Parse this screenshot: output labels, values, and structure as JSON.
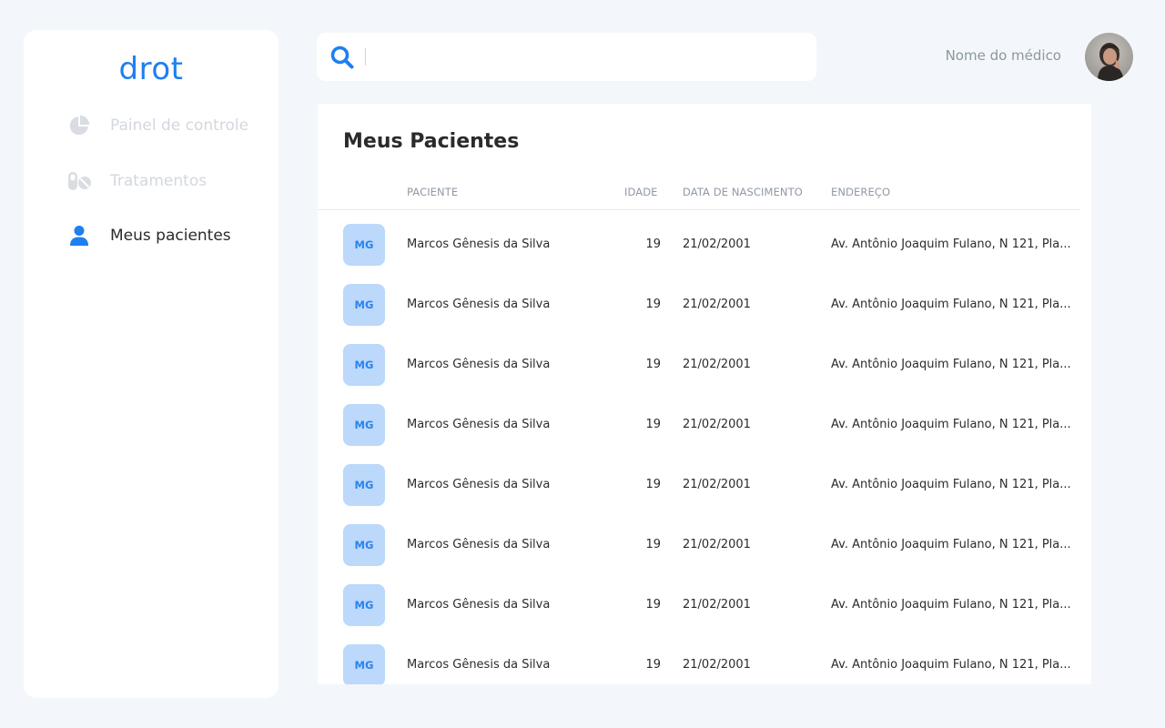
{
  "app": {
    "logo": "drot"
  },
  "sidebar": {
    "items": [
      {
        "label": "Painel de controle",
        "icon": "pie-chart-icon",
        "active": false
      },
      {
        "label": "Tratamentos",
        "icon": "pills-icon",
        "active": false
      },
      {
        "label": "Meus pacientes",
        "icon": "user-icon",
        "active": true
      }
    ]
  },
  "search": {
    "value": "",
    "placeholder": ""
  },
  "header": {
    "doctor_name": "Nome do médico"
  },
  "colors": {
    "accent": "#1e7ff0",
    "badge_bg": "#bcd8fb",
    "muted_nav": "#d3d8de",
    "page_bg": "#f3f7fb"
  },
  "patients": {
    "title": "Meus Pacientes",
    "columns": [
      "PACIENTE",
      "IDADE",
      "DATA DE NASCIMENTO",
      "ENDEREÇO"
    ],
    "rows": [
      {
        "initials": "MG",
        "name": "Marcos Gênesis da Silva",
        "age": "19",
        "dob": "21/02/2001",
        "address": "Av. Antônio Joaquim Fulano, N 121, Pla..."
      },
      {
        "initials": "MG",
        "name": "Marcos Gênesis da Silva",
        "age": "19",
        "dob": "21/02/2001",
        "address": "Av. Antônio Joaquim Fulano, N 121, Pla..."
      },
      {
        "initials": "MG",
        "name": "Marcos Gênesis da Silva",
        "age": "19",
        "dob": "21/02/2001",
        "address": "Av. Antônio Joaquim Fulano, N 121, Pla..."
      },
      {
        "initials": "MG",
        "name": "Marcos Gênesis da Silva",
        "age": "19",
        "dob": "21/02/2001",
        "address": "Av. Antônio Joaquim Fulano, N 121, Pla..."
      },
      {
        "initials": "MG",
        "name": "Marcos Gênesis da Silva",
        "age": "19",
        "dob": "21/02/2001",
        "address": "Av. Antônio Joaquim Fulano, N 121, Pla..."
      },
      {
        "initials": "MG",
        "name": "Marcos Gênesis da Silva",
        "age": "19",
        "dob": "21/02/2001",
        "address": "Av. Antônio Joaquim Fulano, N 121, Pla..."
      },
      {
        "initials": "MG",
        "name": "Marcos Gênesis da Silva",
        "age": "19",
        "dob": "21/02/2001",
        "address": "Av. Antônio Joaquim Fulano, N 121, Pla..."
      },
      {
        "initials": "MG",
        "name": "Marcos Gênesis da Silva",
        "age": "19",
        "dob": "21/02/2001",
        "address": "Av. Antônio Joaquim Fulano, N 121, Pla..."
      }
    ]
  }
}
